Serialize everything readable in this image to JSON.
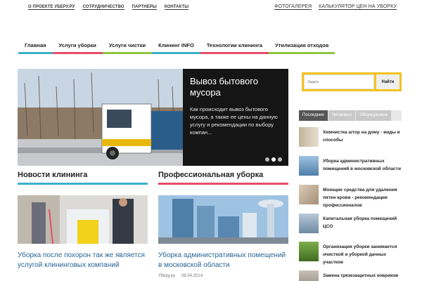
{
  "topbar": {
    "links": [
      "О ПРОЕКТЕ УБЕРУ.РУ",
      "СОТРУДНИЧЕСТВО",
      "ПАРТНЕРЫ",
      "КОНТАКТЫ"
    ],
    "right_links": [
      "ФОТОГАЛЕРЕЯ",
      "КАЛЬКУЛЯТОР ЦЕН НА УБОРКУ"
    ]
  },
  "nav": {
    "items": [
      {
        "label": "Главная",
        "color": "#3bb0c9"
      },
      {
        "label": "Услуги уборки",
        "color": "#e84c6a"
      },
      {
        "label": "Услуги чистки",
        "color": "#8dc63f"
      },
      {
        "label": "Клининг INFO",
        "color": "#3bb0c9"
      },
      {
        "label": "Технологии клининга",
        "color": "#e84c6a"
      },
      {
        "label": "Утилизация отходов",
        "color": "#8dc63f"
      }
    ]
  },
  "slider": {
    "title": "Вывоз бытового мусора",
    "text": "Как происходит вывоз бытового мусора, а также ее цены на данную услугу и рекомендации по выбору компан..."
  },
  "sections": {
    "news": {
      "title": "Новости клининга",
      "color": "#3bb0c9",
      "card_title": "Уборка после похорон так же является услугой клининговых компаний"
    },
    "pro": {
      "title": "Профессиональная уборка",
      "color": "#e84c6a",
      "card_title": "Уборка административных помещений в московской области",
      "author": "Уберу.ру",
      "date": "08.04.2014"
    }
  },
  "search": {
    "placeholder": "Задать",
    "button": "Найти"
  },
  "tabs": [
    "Последние",
    "Читаемые",
    "Обсуждаемые"
  ],
  "sidebar": {
    "items": [
      "Химчистка штор на дому - виды и способы",
      "Уборка административных помещений в московской области",
      "Моющие средства для удаления пятен крови - рекомендации профессионалов",
      "Капитальная уборка помещений ЦСО",
      "Организация уборки занимается очисткой и уборкой дачных участков",
      "Замена грязезащитных ковриков"
    ]
  }
}
